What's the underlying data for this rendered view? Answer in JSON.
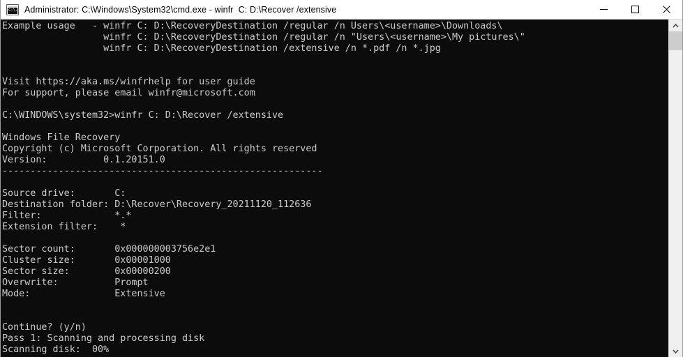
{
  "window": {
    "title": "Administrator: C:\\Windows\\System32\\cmd.exe - winfr  C: D:\\Recover /extensive",
    "icon": "cmd-console-icon",
    "icon_glyph": "C:\\.",
    "controls": {
      "minimize": "minimize-button",
      "maximize": "maximize-button",
      "close": "close-button"
    }
  },
  "console": {
    "background_color": "#0c0c0c",
    "text_color": "#cccccc",
    "lines": [
      "Example usage   - winfr C: D:\\RecoveryDestination /regular /n Users\\<username>\\Downloads\\",
      "                  winfr C: D:\\RecoveryDestination /regular /n \"Users\\<username>\\My pictures\\\"",
      "                  winfr C: D:\\RecoveryDestination /extensive /n *.pdf /n *.jpg",
      "",
      "",
      "Visit https://aka.ms/winfrhelp for user guide",
      "For support, please email winfr@microsoft.com",
      "",
      "C:\\WINDOWS\\system32>winfr C: D:\\Recover /extensive",
      "",
      "Windows File Recovery",
      "Copyright (c) Microsoft Corporation. All rights reserved",
      "Version:          0.1.20151.0",
      "---------------------------------------------------------",
      "",
      "Source drive:       C:",
      "Destination folder: D:\\Recover\\Recovery_20211120_112636",
      "Filter:             *.*",
      "Extension filter:    *",
      "",
      "Sector count:       0x000000003756e2e1",
      "Cluster size:       0x00001000",
      "Sector size:        0x00000200",
      "Overwrite:          Prompt",
      "Mode:               Extensive",
      "",
      "",
      "Continue? (y/n)",
      "Pass 1: Scanning and processing disk",
      "Scanning disk:  00%"
    ],
    "text": "Example usage   - winfr C: D:\\RecoveryDestination /regular /n Users\\<username>\\Downloads\\\n                  winfr C: D:\\RecoveryDestination /regular /n \"Users\\<username>\\My pictures\\\"\n                  winfr C: D:\\RecoveryDestination /extensive /n *.pdf /n *.jpg\n\n\nVisit https://aka.ms/winfrhelp for user guide\nFor support, please email winfr@microsoft.com\n\nC:\\WINDOWS\\system32>winfr C: D:\\Recover /extensive\n\nWindows File Recovery\nCopyright (c) Microsoft Corporation. All rights reserved\nVersion:          0.1.20151.0\n---------------------------------------------------------\n\nSource drive:       C:\nDestination folder: D:\\Recover\\Recovery_20211120_112636\nFilter:             *.*\nExtension filter:    *\n\nSector count:       0x000000003756e2e1\nCluster size:       0x00001000\nSector size:        0x00000200\nOverwrite:          Prompt\nMode:               Extensive\n\n\nContinue? (y/n)\nPass 1: Scanning and processing disk\nScanning disk:  00%"
  },
  "scrollbar": {
    "up_arrow": "chevron-up-icon",
    "down_arrow": "chevron-down-icon",
    "thumb": "scrollbar-thumb"
  },
  "program": {
    "name": "Windows File Recovery",
    "copyright": "Copyright (c) Microsoft Corporation. All rights reserved",
    "version": "0.1.20151.0",
    "source_drive": "C:",
    "destination_folder": "D:\\Recover\\Recovery_20211120_112636",
    "filter": "*.*",
    "extension_filter": "*",
    "sector_count": "0x000000003756e2e1",
    "cluster_size": "0x00001000",
    "sector_size": "0x00000200",
    "overwrite": "Prompt",
    "mode": "Extensive",
    "prompt": "Continue? (y/n)",
    "pass_status": "Pass 1: Scanning and processing disk",
    "scan_progress": "Scanning disk:  00%"
  }
}
